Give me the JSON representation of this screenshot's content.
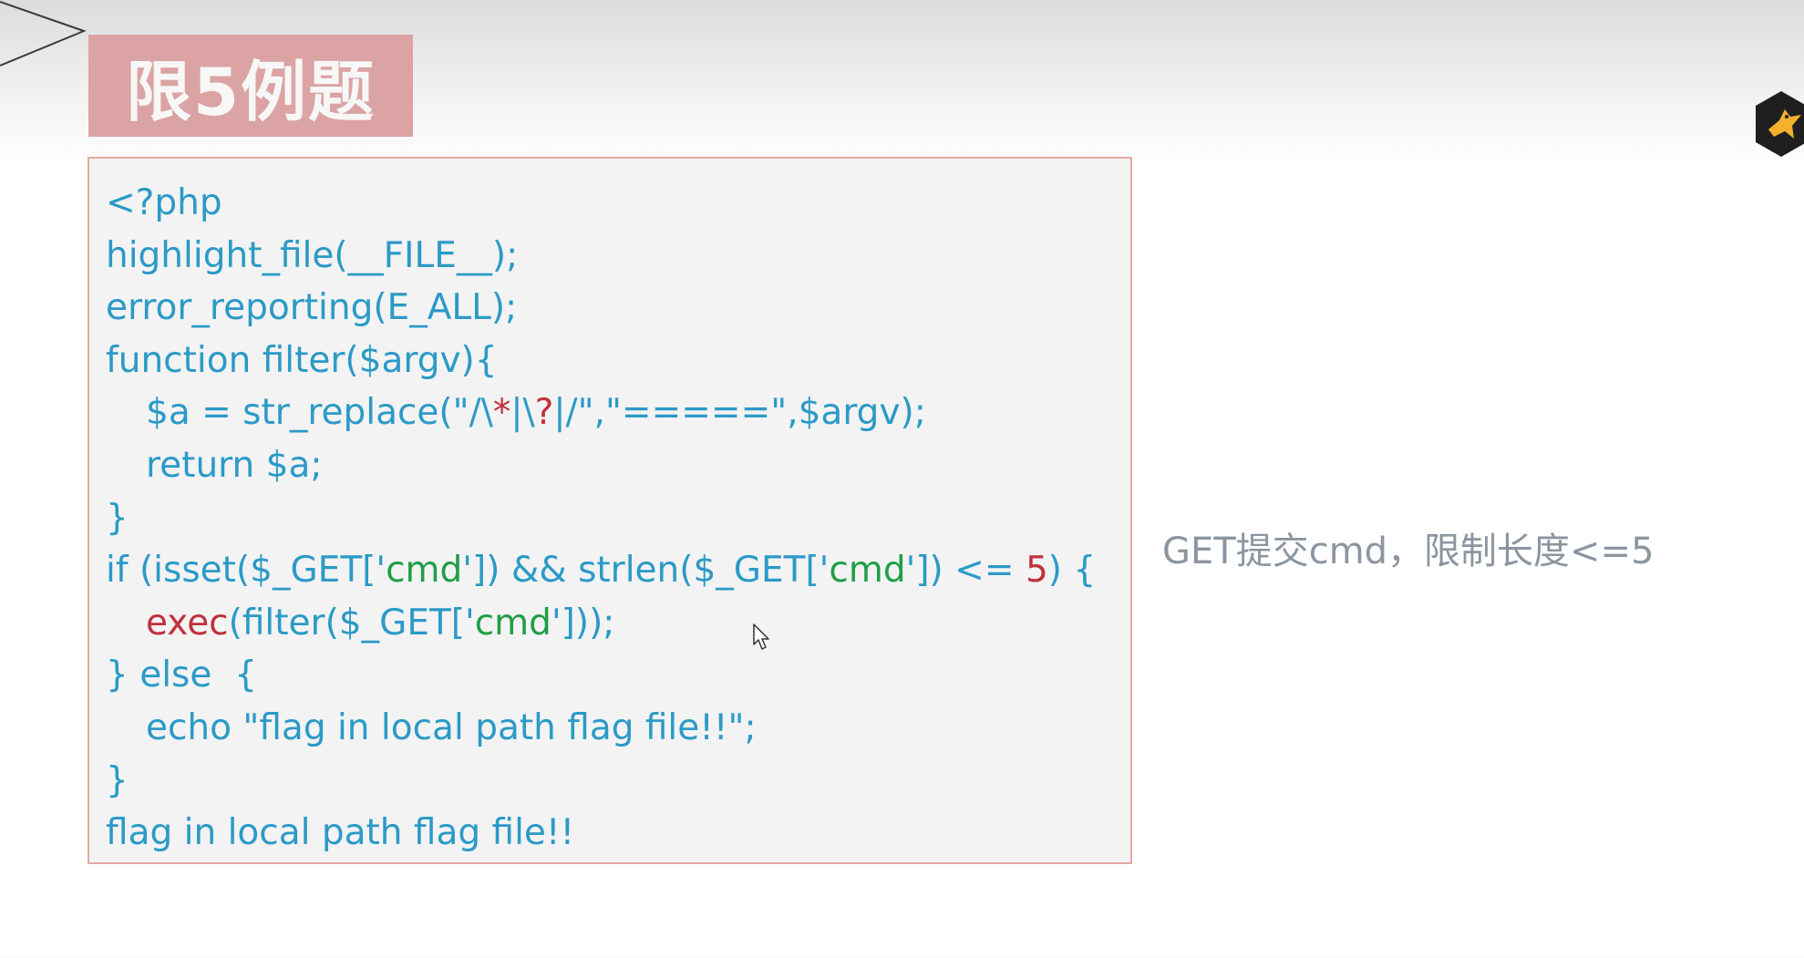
{
  "slide": {
    "title": "限5例题",
    "side_note": "GET提交cmd，限制长度<=5"
  },
  "code": {
    "l1": "<?php",
    "l2": "highlight_file(__FILE__);",
    "l3": "error_reporting(E_ALL);",
    "l4": "function filter($argv){",
    "l5a": "$a = str_replace(\"/\\",
    "l5b": "*",
    "l5c": "|\\",
    "l5d": "?",
    "l5e": "|/\",\"=====\",$argv);",
    "l6": "return $a;",
    "l7": "}",
    "l8a": "if (isset($_GET['",
    "l8b": "cmd",
    "l8c": "']) && strlen($_GET['",
    "l8d": "cmd",
    "l8e": "']) <= ",
    "l8f": "5",
    "l8g": ") {",
    "l9a": "exec",
    "l9b": "(filter($_GET['",
    "l9c": "cmd",
    "l9d": "']));",
    "l10": "} else  {",
    "l11": "echo \"flag in local path flag file!!\";",
    "l12": "}",
    "l13": "flag in local path flag file!!"
  },
  "colors": {
    "code_text": "#2b9ac7",
    "keyword_red": "#c0313e",
    "string_green": "#1f9e48",
    "title_bg": "#dba3a3",
    "border": "#e6a8a2"
  },
  "icons": {
    "cursor": "mouse-pointer-icon",
    "logo": "hexagon-bird-logo-icon",
    "decoration": "triangle-arrow-decoration"
  }
}
